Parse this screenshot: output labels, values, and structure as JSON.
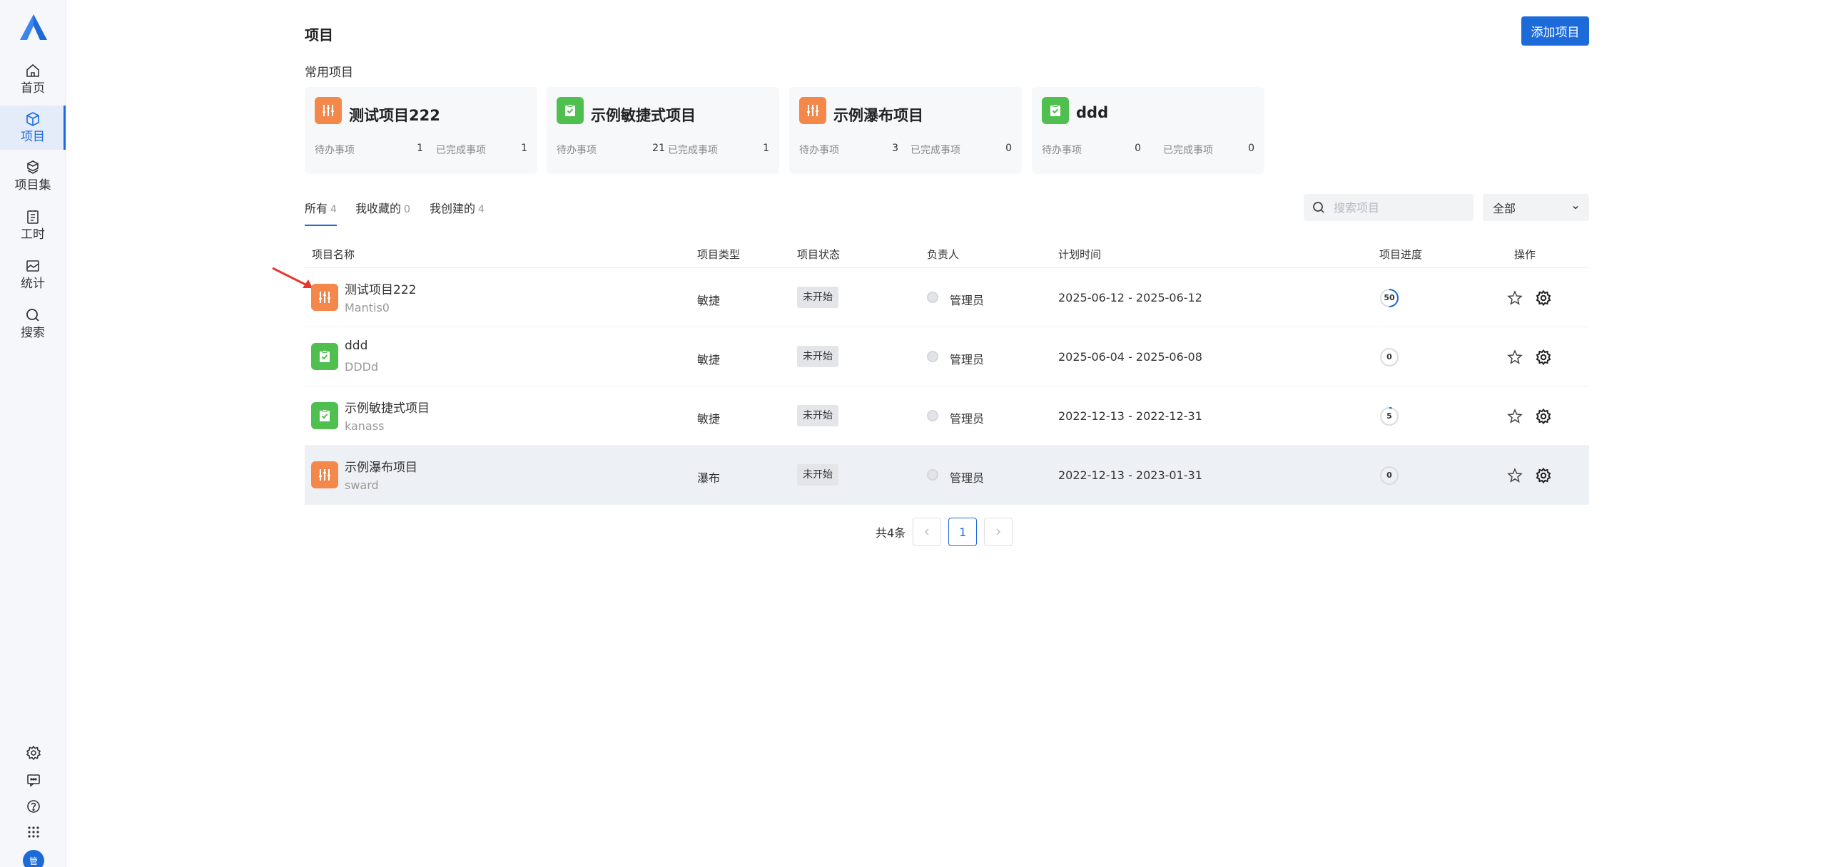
{
  "sidebar": {
    "items": [
      {
        "label": "首页"
      },
      {
        "label": "项目"
      },
      {
        "label": "项目集"
      },
      {
        "label": "工时"
      },
      {
        "label": "统计"
      },
      {
        "label": "搜索"
      }
    ],
    "avatar_text": "管"
  },
  "header": {
    "title": "项目",
    "add_button": "添加项目"
  },
  "favorites": {
    "title": "常用项目",
    "todo_label": "待办事项",
    "done_label": "已完成事项",
    "cards": [
      {
        "name": "测试项目222",
        "todo": "1",
        "done": "1",
        "icon": "waterfall-icon"
      },
      {
        "name": "示例敏捷式项目",
        "todo": "21",
        "done": "1",
        "icon": "agile-icon"
      },
      {
        "name": "示例瀑布项目",
        "todo": "3",
        "done": "0",
        "icon": "waterfall-icon"
      },
      {
        "name": "ddd",
        "todo": "0",
        "done": "0",
        "icon": "agile-icon"
      }
    ]
  },
  "tabs": [
    {
      "label": "所有",
      "count": "4"
    },
    {
      "label": "我收藏的",
      "count": "0"
    },
    {
      "label": "我创建的",
      "count": "4"
    }
  ],
  "search": {
    "placeholder": "搜索项目"
  },
  "filter": {
    "selected": "全部"
  },
  "table": {
    "headers": [
      "项目名称",
      "项目类型",
      "项目状态",
      "负责人",
      "计划时间",
      "项目进度",
      "操作"
    ],
    "rows": [
      {
        "name": "测试项目222",
        "key": "Mantis0",
        "type": "敏捷",
        "status": "未开始",
        "owner": "管理员",
        "time": "2025-06-12 - 2025-06-12",
        "progress": "50",
        "icon": "waterfall-icon"
      },
      {
        "name": "ddd",
        "key": "DDDd",
        "type": "敏捷",
        "status": "未开始",
        "owner": "管理员",
        "time": "2025-06-04 - 2025-06-08",
        "progress": "0",
        "icon": "agile-icon"
      },
      {
        "name": "示例敏捷式项目",
        "key": "kanass",
        "type": "敏捷",
        "status": "未开始",
        "owner": "管理员",
        "time": "2022-12-13 - 2022-12-31",
        "progress": "5",
        "icon": "agile-icon"
      },
      {
        "name": "示例瀑布项目",
        "key": "sward",
        "type": "瀑布",
        "status": "未开始",
        "owner": "管理员",
        "time": "2022-12-13 - 2023-01-31",
        "progress": "0",
        "icon": "waterfall-icon"
      }
    ]
  },
  "pagination": {
    "total": "共4条",
    "current": "1"
  },
  "colors": {
    "accent": "#1d6bd9",
    "orange": "#f4884a",
    "green": "#4fbf4f"
  }
}
